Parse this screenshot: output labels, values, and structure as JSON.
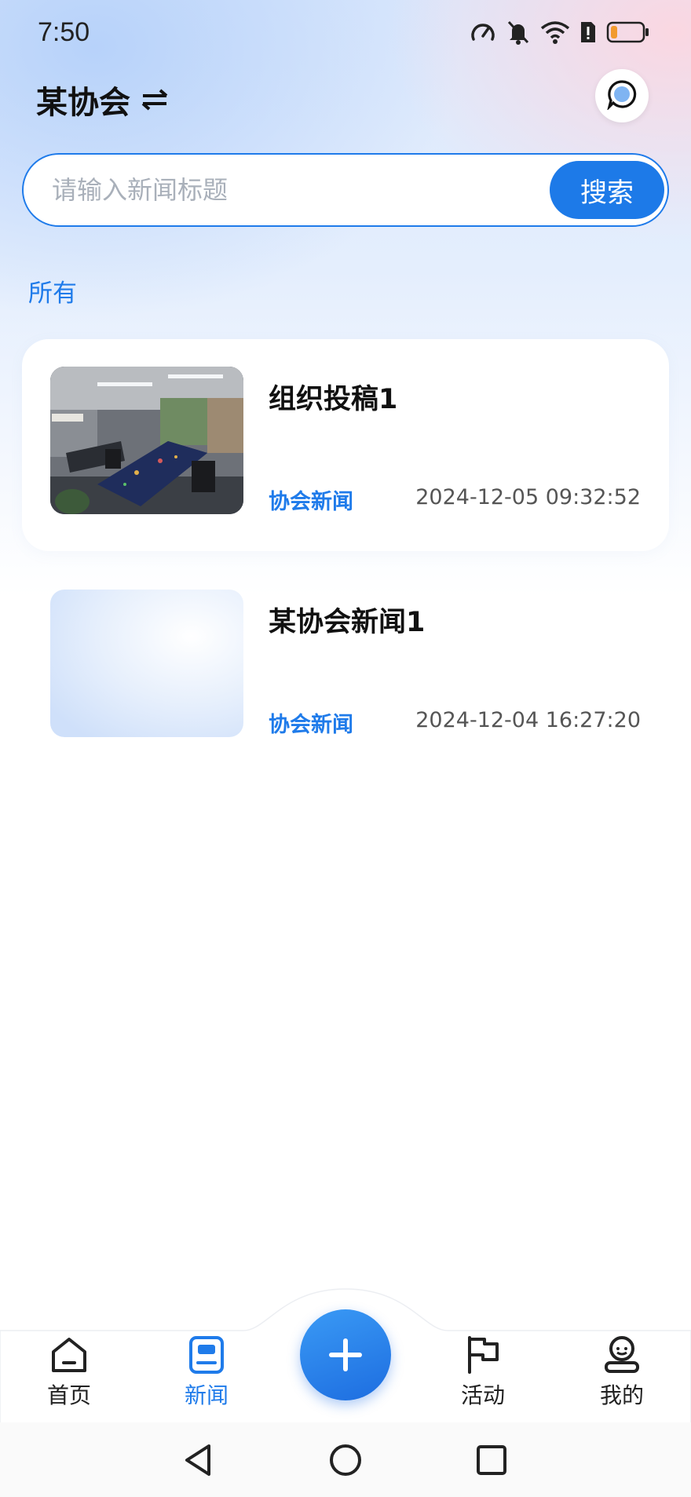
{
  "status_bar": {
    "time": "7:50",
    "icons": [
      "speed-icon",
      "mute-bell-icon",
      "wifi-icon",
      "sim-alert-icon",
      "battery-low-icon"
    ],
    "battery_color": "#f29a2e"
  },
  "header": {
    "title": "某协会",
    "switch_icon": "swap-icon",
    "message_icon": "chat-bubble-icon"
  },
  "search": {
    "placeholder": "请输入新闻标题",
    "value": "",
    "button_label": "搜索"
  },
  "filter": {
    "selected": "所有"
  },
  "news_list": [
    {
      "title": "组织投稿1",
      "category": "协会新闻",
      "time": "2024-12-05 09:32:52",
      "thumbnail": "office-meeting-room-photo"
    },
    {
      "title": "某协会新闻1",
      "category": "协会新闻",
      "time": "2024-12-04 16:27:20",
      "thumbnail": "placeholder-gradient"
    }
  ],
  "bottom_nav": {
    "items": [
      {
        "label": "首页",
        "icon": "home-icon",
        "active": false
      },
      {
        "label": "新闻",
        "icon": "news-icon",
        "active": true
      },
      {
        "label": "活动",
        "icon": "flag-icon",
        "active": false
      },
      {
        "label": "我的",
        "icon": "user-icon",
        "active": false
      }
    ],
    "fab_icon": "plus-icon"
  },
  "system_nav": {
    "icons": [
      "back-triangle-icon",
      "home-circle-icon",
      "recents-square-icon"
    ]
  },
  "colors": {
    "accent": "#1f7bea",
    "text": "#111111",
    "muted": "#555555"
  }
}
